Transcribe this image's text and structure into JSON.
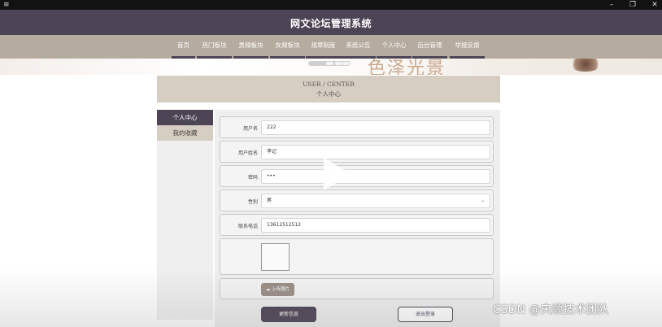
{
  "window": {
    "menu_icon": "≡",
    "minimize": "–",
    "restore": "❐",
    "close": "✕"
  },
  "header": {
    "title": "网文论坛管理系统"
  },
  "nav": {
    "items": [
      {
        "label": "首页"
      },
      {
        "label": "热门板块"
      },
      {
        "label": "男频板块"
      },
      {
        "label": "女频板块"
      },
      {
        "label": "规章制度"
      },
      {
        "label": "系统公告"
      },
      {
        "label": "个人中心"
      },
      {
        "label": "后台管理"
      },
      {
        "label": "举报反馈"
      }
    ],
    "active_index": 6
  },
  "banner": {
    "text": "色泽光景"
  },
  "user_center": {
    "title_en": "USER / CENTER",
    "title_cn": "个人中心"
  },
  "sidebar": {
    "items": [
      {
        "label": "个人中心"
      },
      {
        "label": "我的收藏"
      }
    ]
  },
  "form": {
    "username_label": "用户名",
    "username_value": "222",
    "realname_label": "用户姓名",
    "realname_value": "李记",
    "password_label": "密码",
    "password_value": "•••",
    "gender_label": "性别",
    "gender_value": "男",
    "phone_label": "联系电话",
    "phone_value": "13612512512",
    "upload_label": "上传图片",
    "update_label": "更新信息",
    "logout_label": "退出登录"
  },
  "watermark": "CSDN @央顺技术团队",
  "colors": {
    "brand": "#4d4455",
    "nav_bg": "#b5ab9f",
    "panel": "#d7cec3"
  }
}
